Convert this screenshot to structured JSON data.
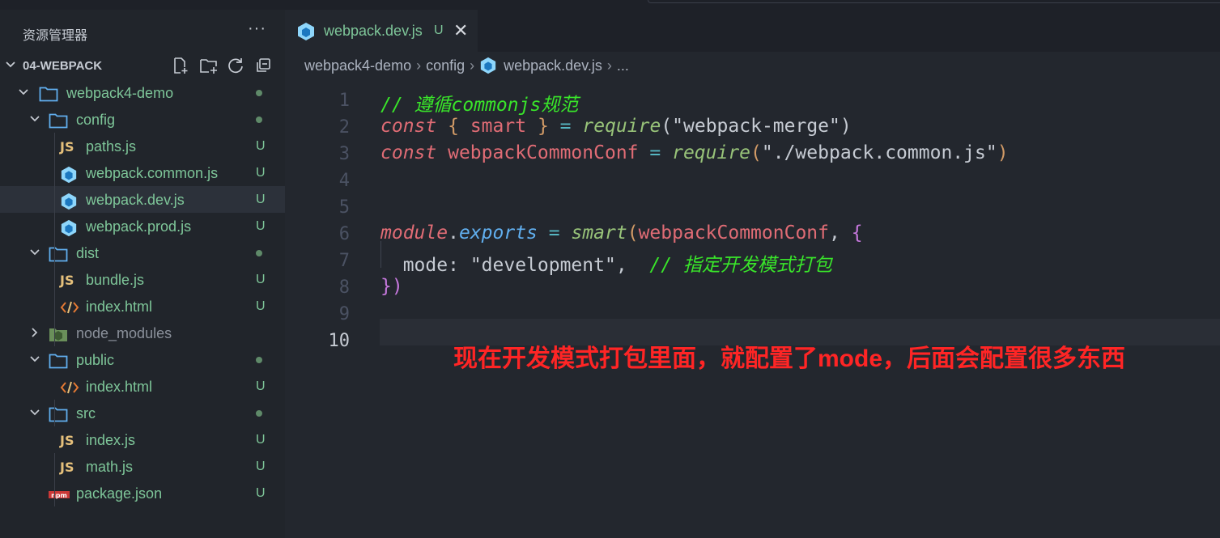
{
  "explorer": {
    "title": "资源管理器",
    "more": "···",
    "project": "04-WEBPACK",
    "tree": [
      {
        "label": "webpack4-demo",
        "kind": "folder",
        "open": true,
        "depth": 1,
        "status": "dot"
      },
      {
        "label": "config",
        "kind": "folder",
        "open": true,
        "depth": 2,
        "status": "dot"
      },
      {
        "label": "paths.js",
        "kind": "js",
        "depth": 3,
        "status": "U"
      },
      {
        "label": "webpack.common.js",
        "kind": "webpack",
        "depth": 3,
        "status": "U"
      },
      {
        "label": "webpack.dev.js",
        "kind": "webpack",
        "depth": 3,
        "status": "U",
        "selected": true
      },
      {
        "label": "webpack.prod.js",
        "kind": "webpack",
        "depth": 3,
        "status": "U"
      },
      {
        "label": "dist",
        "kind": "folder",
        "open": true,
        "depth": 2,
        "status": "dot"
      },
      {
        "label": "bundle.js",
        "kind": "js",
        "depth": 3,
        "status": "U"
      },
      {
        "label": "index.html",
        "kind": "html",
        "depth": 3,
        "status": "U"
      },
      {
        "label": "node_modules",
        "kind": "node",
        "open": false,
        "depth": 2,
        "status": "",
        "dim": true
      },
      {
        "label": "public",
        "kind": "folder",
        "open": true,
        "depth": 2,
        "status": "dot"
      },
      {
        "label": "index.html",
        "kind": "html",
        "depth": 3,
        "status": "U"
      },
      {
        "label": "src",
        "kind": "folder",
        "open": true,
        "depth": 2,
        "status": "dot"
      },
      {
        "label": "index.js",
        "kind": "js",
        "depth": 3,
        "status": "U"
      },
      {
        "label": "math.js",
        "kind": "js",
        "depth": 3,
        "status": "U"
      },
      {
        "label": "package.json",
        "kind": "npm",
        "depth": 2,
        "status": "U"
      }
    ]
  },
  "tab": {
    "label": "webpack.dev.js",
    "status": "U",
    "close": "✕"
  },
  "breadcrumb": {
    "root": "webpack4-demo",
    "folder": "config",
    "file": "webpack.dev.js",
    "ellipsis": "..."
  },
  "code": {
    "line_numbers": [
      "1",
      "2",
      "3",
      "4",
      "5",
      "6",
      "7",
      "8",
      "9",
      "10"
    ],
    "current_line": "10",
    "l1_comment": "// 遵循commonjs规范",
    "l2_kw": "const",
    "l2_open": "{",
    "l2_var": "smart",
    "l2_close": "}",
    "l2_eq": "=",
    "l2_fn": "require",
    "l2_str": "\"webpack-merge\"",
    "l3_kw": "const",
    "l3_var": "webpackCommonConf",
    "l3_eq": "=",
    "l3_fn": "require",
    "l3_str": "\"./webpack.common.js\"",
    "l6_obj": "module",
    "l6_dot": ".",
    "l6_prop": "exports",
    "l6_eq": "=",
    "l6_fn": "smart",
    "l6_arg": "webpackCommonConf",
    "l6_comma": ",",
    "l6_brace": "{",
    "l7_key": "mode",
    "l7_colon": ":",
    "l7_str": "\"development\"",
    "l7_comma": ",",
    "l7_comment": "// 指定开发模式打包",
    "l8_close": "})"
  },
  "annotation": "现在开发模式打包里面，就配置了mode，后面会配置很多东西",
  "colors": {
    "accent_green": "#7ec699",
    "comment_green": "#39e52a",
    "annotation_red": "#ff2525",
    "webpack_blue": "#1c78c0"
  }
}
